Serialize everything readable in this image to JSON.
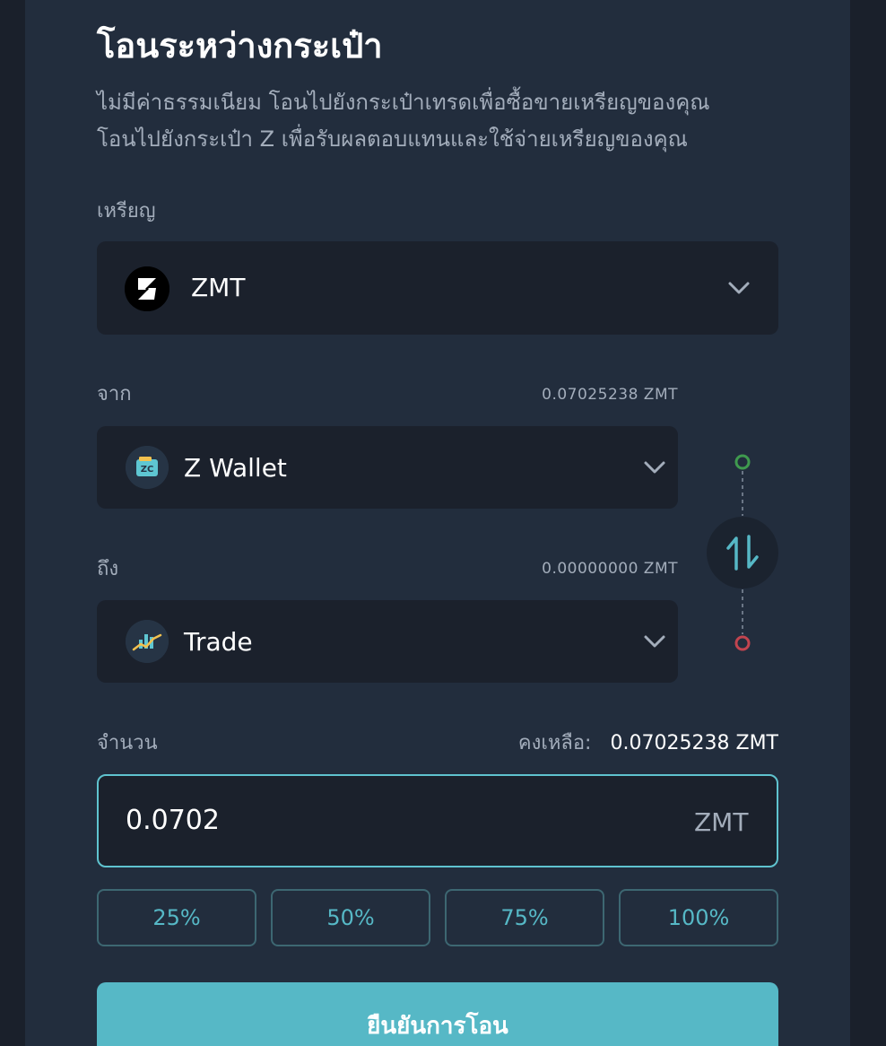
{
  "header": {
    "title": "โอนระหว่างกระเป๋า",
    "description_line1": "ไม่มีค่าธรรมเนียม โอนไปยังกระเป๋าเทรดเพื่อซื้อขายเหรียญของคุณ",
    "description_line2": "โอนไปยังกระเป๋า Z เพื่อรับผลตอบแทนและใช้จ่ายเหรียญของคุณ"
  },
  "coin": {
    "label": "เหรียญ",
    "selected": "ZMT",
    "icon": "zmt-logo-icon"
  },
  "from": {
    "label": "จาก",
    "balance": "0.07025238 ZMT",
    "wallet": "Z Wallet",
    "icon": "z-wallet-icon"
  },
  "to": {
    "label": "ถึง",
    "balance": "0.00000000 ZMT",
    "wallet": "Trade",
    "icon": "trade-chart-icon"
  },
  "swap": {
    "icon": "swap-arrows-icon"
  },
  "amount": {
    "label": "จำนวน",
    "remaining_label": "คงเหลือ:",
    "remaining_value": "0.07025238 ZMT",
    "value": "0.0702",
    "unit": "ZMT"
  },
  "percent_buttons": [
    "25%",
    "50%",
    "75%",
    "100%"
  ],
  "confirm_label": "ยืนยันการโอน",
  "colors": {
    "background": "#1a202b",
    "panel": "#222d3d",
    "field": "#1b212c",
    "accent": "#56b8c6",
    "from_dot": "#3f9a4e",
    "to_dot": "#c2444f"
  }
}
